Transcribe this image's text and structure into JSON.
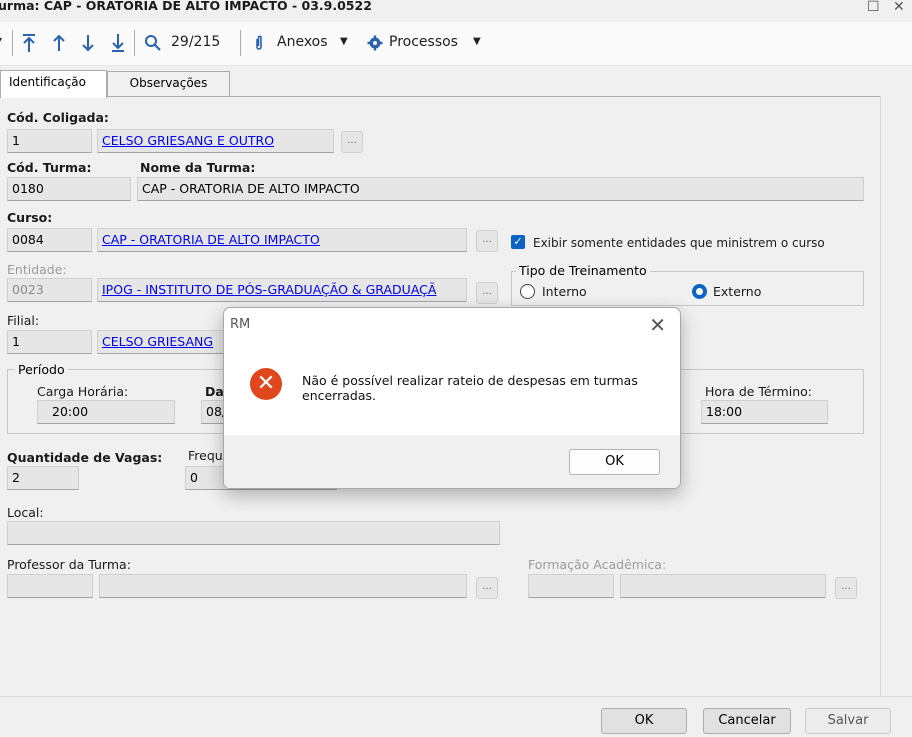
{
  "window": {
    "title": "urma: CAP - ORATORIA DE ALTO IMPACTO - 03.9.0522",
    "maximize_glyph": "☐",
    "close_glyph": "✕"
  },
  "toolbar": {
    "first_icon": "arrow-to-top-icon",
    "up_icon": "arrow-up-icon",
    "down_icon": "arrow-down-icon",
    "last_icon": "arrow-to-bottom-icon",
    "search_icon": "search-icon",
    "record_position": "29/215",
    "attachments_label": "Anexos",
    "processes_label": "Processos"
  },
  "tabs": [
    {
      "label": "Identificação"
    },
    {
      "label": "Observações"
    }
  ],
  "form": {
    "coligada": {
      "label": "Cód. Coligada:",
      "code": "1",
      "name": "CELSO GRIESANG E OUTRO"
    },
    "turma": {
      "code_label": "Cód. Turma:",
      "code": "0180",
      "name_label": "Nome da Turma:",
      "name": "CAP - ORATORIA DE ALTO IMPACTO"
    },
    "curso": {
      "label": "Curso:",
      "code": "0084",
      "name": "CAP - ORATORIA DE ALTO IMPACTO",
      "filter_checkbox_label": "Exibir somente entidades que ministrem o curso"
    },
    "entidade": {
      "label": "Entidade:",
      "code": "0023",
      "name": "IPOG - INSTITUTO DE PÓS-GRADUAÇÃO & GRADUAÇÃ"
    },
    "tipo_treinamento": {
      "title": "Tipo de Treinamento",
      "option_interno": "Interno",
      "option_externo": "Externo",
      "selected": "Externo"
    },
    "filial": {
      "label": "Filial:",
      "code": "1",
      "name": "CELSO GRIESANG"
    },
    "periodo": {
      "title": "Período",
      "carga_horaria_label": "Carga Horária:",
      "carga_horaria": "20:00",
      "data_label": "Da",
      "data_value": "08/",
      "hora_termino_label": "Hora de Término:",
      "hora_termino": "18:00"
    },
    "vagas": {
      "label": "Quantidade de Vagas:",
      "value": "2"
    },
    "frequencia": {
      "label": "Freque",
      "value": "0"
    },
    "local": {
      "label": "Local:",
      "value": ""
    },
    "professor": {
      "label": "Professor da Turma:",
      "code": "",
      "name": ""
    },
    "formacao": {
      "label": "Formação Acadêmica:",
      "code": "",
      "name": ""
    },
    "lookup_button": "..."
  },
  "footer": {
    "ok_label": "OK",
    "cancel_label": "Cancelar",
    "save_label": "Salvar"
  },
  "dialog": {
    "title": "RM",
    "icon": "error-icon",
    "message": "Não é possível realizar rateio de despesas em turmas encerradas.",
    "ok_label": "OK"
  },
  "colors": {
    "accent": "#0b63c4",
    "error": "#e0471d",
    "link": "#1a1ae6"
  }
}
